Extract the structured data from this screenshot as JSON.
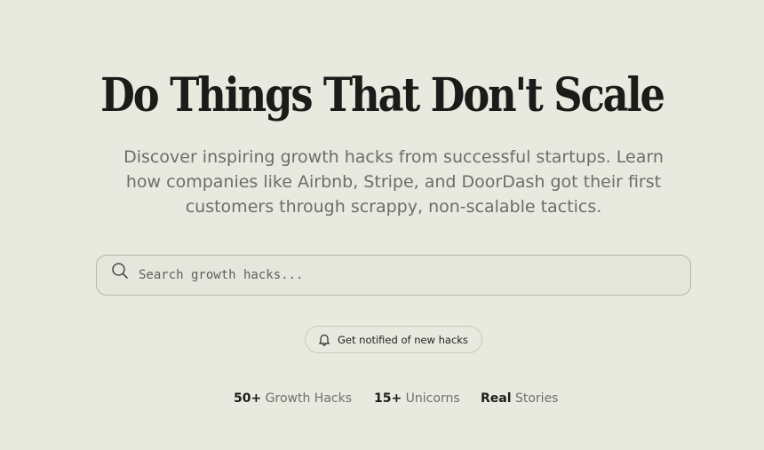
{
  "hero": {
    "title": "Do Things That Don't Scale",
    "subtitle": "Discover inspiring growth hacks from successful startups. Learn how companies like Airbnb, Stripe, and DoorDash got their first customers through scrappy, non-scalable tactics."
  },
  "search": {
    "placeholder": "Search growth hacks...",
    "value": "",
    "icon": "search-icon"
  },
  "notify": {
    "label": "Get notified of new hacks",
    "icon": "bell-icon"
  },
  "stats": [
    {
      "value": "50+",
      "label": "Growth Hacks"
    },
    {
      "value": "15+",
      "label": "Unicorns"
    },
    {
      "value": "Real",
      "label": "Stories"
    }
  ],
  "colors": {
    "background": "#e8e9df",
    "title": "#1b1b19",
    "muted_text": "#6e6e66",
    "border": "#b4b8a6"
  }
}
